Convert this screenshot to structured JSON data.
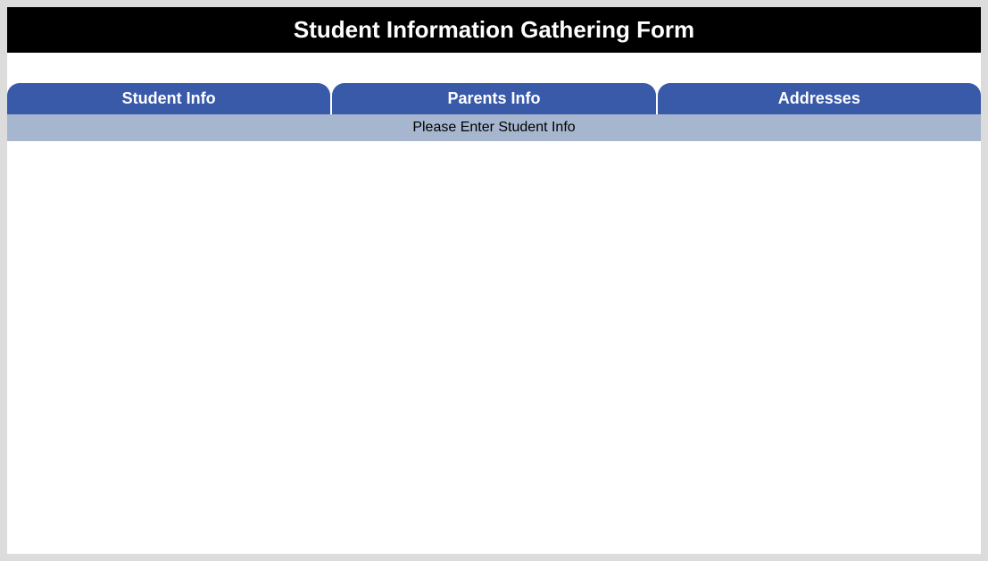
{
  "header": {
    "title": "Student Information Gathering Form"
  },
  "tabs": {
    "items": [
      {
        "label": "Student Info"
      },
      {
        "label": "Parents Info"
      },
      {
        "label": "Addresses"
      }
    ]
  },
  "instruction": {
    "text": "Please Enter Student Info"
  },
  "colors": {
    "header_bg": "#000000",
    "tab_bg": "#3959a9",
    "instruction_bg": "#a5b6ce",
    "page_bg": "#dcdcdc"
  }
}
